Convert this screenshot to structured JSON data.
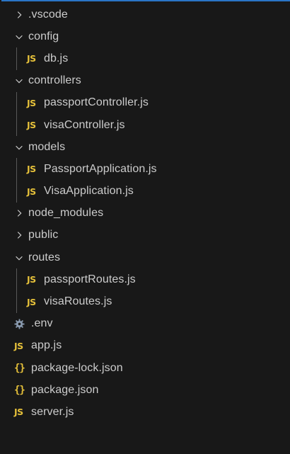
{
  "explorer": {
    "items": [
      {
        "label": ".vscode",
        "type": "folder",
        "expanded": false,
        "depth": 0,
        "icon": "chevron-right-icon"
      },
      {
        "label": "config",
        "type": "folder",
        "expanded": true,
        "depth": 0,
        "icon": "chevron-down-icon"
      },
      {
        "label": "db.js",
        "type": "file",
        "depth": 1,
        "icon": "js-file-icon",
        "icon_text": "JS"
      },
      {
        "label": "controllers",
        "type": "folder",
        "expanded": true,
        "depth": 0,
        "icon": "chevron-down-icon"
      },
      {
        "label": "passportController.js",
        "type": "file",
        "depth": 1,
        "icon": "js-file-icon",
        "icon_text": "JS"
      },
      {
        "label": "visaController.js",
        "type": "file",
        "depth": 1,
        "icon": "js-file-icon",
        "icon_text": "JS"
      },
      {
        "label": "models",
        "type": "folder",
        "expanded": true,
        "depth": 0,
        "icon": "chevron-down-icon"
      },
      {
        "label": "PassportApplication.js",
        "type": "file",
        "depth": 1,
        "icon": "js-file-icon",
        "icon_text": "JS"
      },
      {
        "label": "VisaApplication.js",
        "type": "file",
        "depth": 1,
        "icon": "js-file-icon",
        "icon_text": "JS"
      },
      {
        "label": "node_modules",
        "type": "folder",
        "expanded": false,
        "depth": 0,
        "icon": "chevron-right-icon"
      },
      {
        "label": "public",
        "type": "folder",
        "expanded": false,
        "depth": 0,
        "icon": "chevron-right-icon"
      },
      {
        "label": "routes",
        "type": "folder",
        "expanded": true,
        "depth": 0,
        "icon": "chevron-down-icon"
      },
      {
        "label": "passportRoutes.js",
        "type": "file",
        "depth": 1,
        "icon": "js-file-icon",
        "icon_text": "JS"
      },
      {
        "label": "visaRoutes.js",
        "type": "file",
        "depth": 1,
        "icon": "js-file-icon",
        "icon_text": "JS"
      },
      {
        "label": ".env",
        "type": "file",
        "depth": 0,
        "icon": "gear-icon"
      },
      {
        "label": "app.js",
        "type": "file",
        "depth": 0,
        "icon": "js-file-icon",
        "icon_text": "JS"
      },
      {
        "label": "package-lock.json",
        "type": "file",
        "depth": 0,
        "icon": "json-file-icon",
        "icon_text": "{}"
      },
      {
        "label": "package.json",
        "type": "file",
        "depth": 0,
        "icon": "json-file-icon",
        "icon_text": "{}"
      },
      {
        "label": "server.js",
        "type": "file",
        "depth": 0,
        "icon": "js-file-icon",
        "icon_text": "JS"
      }
    ]
  },
  "colors": {
    "background": "#181818",
    "text": "#cccccc",
    "js_icon": "#e6c13a",
    "json_icon": "#e6c13a",
    "gear_icon": "#8a9bb0",
    "indent_guide": "#585858",
    "top_border": "#2a75c7"
  }
}
